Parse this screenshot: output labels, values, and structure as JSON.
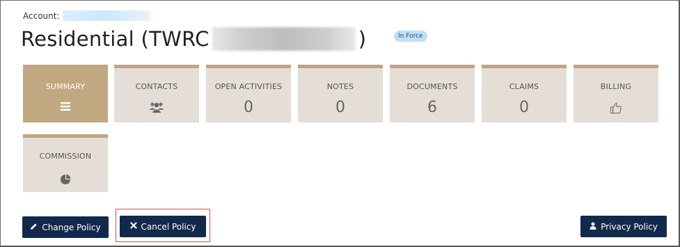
{
  "account": {
    "label": "Account:"
  },
  "policy": {
    "title_prefix": "Residential (TWRC",
    "title_suffix": ")",
    "status": "In Force"
  },
  "tiles": [
    {
      "label": "SUMMARY",
      "count": null,
      "icon": "hamburger-menu-icon",
      "active": true
    },
    {
      "label": "CONTACTS",
      "count": null,
      "icon": "users-group-icon",
      "active": false
    },
    {
      "label": "OPEN ACTIVITIES",
      "count": "0",
      "icon": null,
      "active": false
    },
    {
      "label": "NOTES",
      "count": "0",
      "icon": null,
      "active": false
    },
    {
      "label": "DOCUMENTS",
      "count": "6",
      "icon": null,
      "active": false
    },
    {
      "label": "CLAIMS",
      "count": "0",
      "icon": null,
      "active": false
    },
    {
      "label": "BILLING",
      "count": null,
      "icon": "thumbs-up-icon",
      "active": false
    },
    {
      "label": "COMMISSION",
      "count": null,
      "icon": "pie-chart-icon",
      "active": false
    }
  ],
  "buttons": {
    "change_policy": "Change Policy",
    "cancel_policy": "Cancel Policy",
    "privacy_policy": "Privacy Policy"
  },
  "colors": {
    "tile_bg": "#e4ded7",
    "tile_accent": "#bfa57f",
    "tile_active": "#c2a880",
    "button_bg": "#13294b",
    "badge_bg": "#bfe0f6",
    "highlight": "#e0474c"
  }
}
